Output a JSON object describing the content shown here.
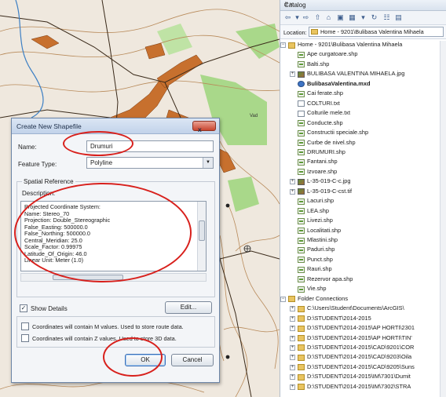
{
  "map": {
    "labels": [
      "Vad"
    ]
  },
  "dialog": {
    "title": "Create New Shapefile",
    "name_label": "Name:",
    "name_value": "Drumuri",
    "feature_type_label": "Feature Type:",
    "feature_type_value": "Polyline",
    "spatial_reference_label": "Spatial Reference",
    "description_label": "Description:",
    "description_lines": [
      "Projected Coordinate System:",
      "Name: Stereo_70",
      "Projection: Double_Stereographic",
      "False_Easting: 500000.0",
      "False_Northing: 500000.0",
      "Central_Meridian: 25.0",
      "Scale_Factor: 0.99975",
      "Latitude_Of_Origin: 46.0",
      "Linear Unit: Meter (1.0)"
    ],
    "show_details_label": "Show Details",
    "show_details_checked": true,
    "edit_button": "Edit...",
    "m_values_label": "Coordinates will contain M values. Used to store route data.",
    "z_values_label": "Coordinates will contain Z values. Used to store 3D data.",
    "ok_button": "OK",
    "cancel_button": "Cancel",
    "close_glyph": "x"
  },
  "catalog": {
    "title": "Catalog",
    "pin_glyph": "# ×",
    "location_label": "Location:",
    "location_value": "Home - 9201\\Bulibasa Valentina Mihaela",
    "tree": [
      {
        "text": "Home - 9201\\Bulibasa Valentina Mihaela",
        "icon": "folder",
        "level": 0,
        "expander": "−"
      },
      {
        "text": "Ape curgatoare.shp",
        "icon": "shp",
        "level": 1
      },
      {
        "text": "Balti.shp",
        "icon": "shp",
        "level": 1
      },
      {
        "text": "BULIBASA VALENTINA MIHAELA.jpg",
        "icon": "img",
        "level": 1,
        "expander": "+"
      },
      {
        "text": "BulibasaValentina.mxd",
        "icon": "mxd",
        "level": 1,
        "bold": true
      },
      {
        "text": "Cai ferate.shp",
        "icon": "shp",
        "level": 1
      },
      {
        "text": "COLTURI.txt",
        "icon": "txt",
        "level": 1
      },
      {
        "text": "Colturile mele.txt",
        "icon": "txt",
        "level": 1
      },
      {
        "text": "Conducte.shp",
        "icon": "shp",
        "level": 1
      },
      {
        "text": "Constructii speciale.shp",
        "icon": "shp",
        "level": 1
      },
      {
        "text": "Curbe de nivel.shp",
        "icon": "shp",
        "level": 1
      },
      {
        "text": "DRUMURI.shp",
        "icon": "shp",
        "level": 1
      },
      {
        "text": "Fantani.shp",
        "icon": "shp",
        "level": 1
      },
      {
        "text": "Izvoare.shp",
        "icon": "shp",
        "level": 1
      },
      {
        "text": "L-35-019-C-c.jpg",
        "icon": "img",
        "level": 1,
        "expander": "+"
      },
      {
        "text": "L-35-019-C-cst.tif",
        "icon": "img",
        "level": 1,
        "expander": "+"
      },
      {
        "text": "Lacuri.shp",
        "icon": "shp",
        "level": 1
      },
      {
        "text": "LEA.shp",
        "icon": "shp",
        "level": 1
      },
      {
        "text": "Livezi.shp",
        "icon": "shp",
        "level": 1
      },
      {
        "text": "Localitati.shp",
        "icon": "shp",
        "level": 1
      },
      {
        "text": "Mlastini.shp",
        "icon": "shp",
        "level": 1
      },
      {
        "text": "Paduri.shp",
        "icon": "shp",
        "level": 1
      },
      {
        "text": "Punct.shp",
        "icon": "shp",
        "level": 1
      },
      {
        "text": "Rauri.shp",
        "icon": "shp",
        "level": 1
      },
      {
        "text": "Rezervor apa.shp",
        "icon": "shp",
        "level": 1
      },
      {
        "text": "Vie.shp",
        "icon": "shp",
        "level": 1
      },
      {
        "text": "Folder Connections",
        "icon": "fconn",
        "level": 0,
        "expander": "−"
      },
      {
        "text": "C:\\Users\\Student\\Documents\\ArcGIS\\",
        "icon": "folder",
        "level": 1,
        "expander": "+"
      },
      {
        "text": "D:\\STUDENT\\2014-2015",
        "icon": "folder",
        "level": 1,
        "expander": "+"
      },
      {
        "text": "D:\\STUDENT\\2014-2015\\AP HORTI\\2301",
        "icon": "folder",
        "level": 1,
        "expander": "+"
      },
      {
        "text": "D:\\STUDENT\\2014-2015\\AP HORTI\\TIN'",
        "icon": "folder",
        "level": 1,
        "expander": "+"
      },
      {
        "text": "D:\\STUDENT\\2014-2015\\CAD\\9201\\COR",
        "icon": "folder",
        "level": 1,
        "expander": "+"
      },
      {
        "text": "D:\\STUDENT\\2014-2015\\CAD\\9203\\Oila",
        "icon": "folder",
        "level": 1,
        "expander": "+"
      },
      {
        "text": "D:\\STUDENT\\2014-2015\\CAD\\9205\\Suns",
        "icon": "folder",
        "level": 1,
        "expander": "+"
      },
      {
        "text": "D:\\STUDENT\\2014-2015\\IM\\7301\\Dumit",
        "icon": "folder",
        "level": 1,
        "expander": "+"
      },
      {
        "text": "D:\\STUDENT\\2014-2015\\IM\\7302\\STRA",
        "icon": "folder",
        "level": 1,
        "expander": "+"
      }
    ]
  },
  "colors": {
    "annotation": "#d8201c",
    "map_background": "#efe8de",
    "urban_fill": "#c7702e",
    "green_fill": "#a9d88a"
  }
}
